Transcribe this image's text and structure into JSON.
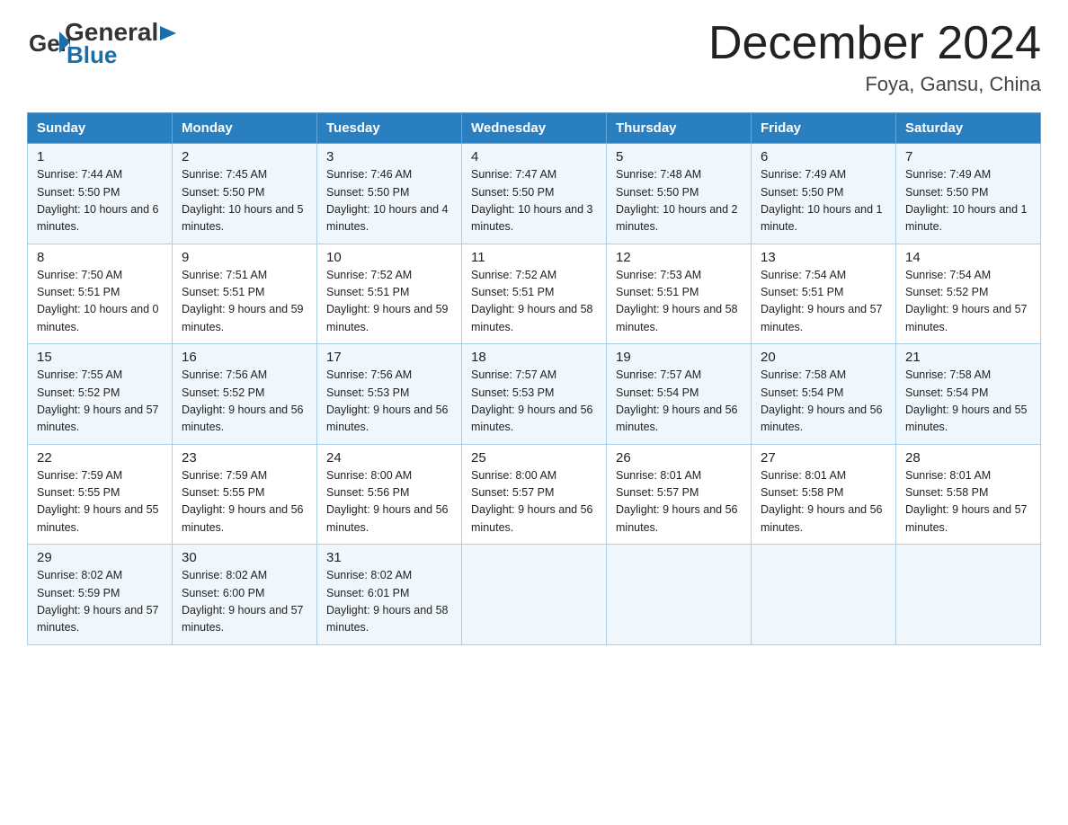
{
  "header": {
    "logo_general": "General",
    "logo_blue": "Blue",
    "month_title": "December 2024",
    "location": "Foya, Gansu, China"
  },
  "days_of_week": [
    "Sunday",
    "Monday",
    "Tuesday",
    "Wednesday",
    "Thursday",
    "Friday",
    "Saturday"
  ],
  "weeks": [
    [
      {
        "day": "1",
        "sunrise": "7:44 AM",
        "sunset": "5:50 PM",
        "daylight": "10 hours and 6 minutes."
      },
      {
        "day": "2",
        "sunrise": "7:45 AM",
        "sunset": "5:50 PM",
        "daylight": "10 hours and 5 minutes."
      },
      {
        "day": "3",
        "sunrise": "7:46 AM",
        "sunset": "5:50 PM",
        "daylight": "10 hours and 4 minutes."
      },
      {
        "day": "4",
        "sunrise": "7:47 AM",
        "sunset": "5:50 PM",
        "daylight": "10 hours and 3 minutes."
      },
      {
        "day": "5",
        "sunrise": "7:48 AM",
        "sunset": "5:50 PM",
        "daylight": "10 hours and 2 minutes."
      },
      {
        "day": "6",
        "sunrise": "7:49 AM",
        "sunset": "5:50 PM",
        "daylight": "10 hours and 1 minute."
      },
      {
        "day": "7",
        "sunrise": "7:49 AM",
        "sunset": "5:50 PM",
        "daylight": "10 hours and 1 minute."
      }
    ],
    [
      {
        "day": "8",
        "sunrise": "7:50 AM",
        "sunset": "5:51 PM",
        "daylight": "10 hours and 0 minutes."
      },
      {
        "day": "9",
        "sunrise": "7:51 AM",
        "sunset": "5:51 PM",
        "daylight": "9 hours and 59 minutes."
      },
      {
        "day": "10",
        "sunrise": "7:52 AM",
        "sunset": "5:51 PM",
        "daylight": "9 hours and 59 minutes."
      },
      {
        "day": "11",
        "sunrise": "7:52 AM",
        "sunset": "5:51 PM",
        "daylight": "9 hours and 58 minutes."
      },
      {
        "day": "12",
        "sunrise": "7:53 AM",
        "sunset": "5:51 PM",
        "daylight": "9 hours and 58 minutes."
      },
      {
        "day": "13",
        "sunrise": "7:54 AM",
        "sunset": "5:51 PM",
        "daylight": "9 hours and 57 minutes."
      },
      {
        "day": "14",
        "sunrise": "7:54 AM",
        "sunset": "5:52 PM",
        "daylight": "9 hours and 57 minutes."
      }
    ],
    [
      {
        "day": "15",
        "sunrise": "7:55 AM",
        "sunset": "5:52 PM",
        "daylight": "9 hours and 57 minutes."
      },
      {
        "day": "16",
        "sunrise": "7:56 AM",
        "sunset": "5:52 PM",
        "daylight": "9 hours and 56 minutes."
      },
      {
        "day": "17",
        "sunrise": "7:56 AM",
        "sunset": "5:53 PM",
        "daylight": "9 hours and 56 minutes."
      },
      {
        "day": "18",
        "sunrise": "7:57 AM",
        "sunset": "5:53 PM",
        "daylight": "9 hours and 56 minutes."
      },
      {
        "day": "19",
        "sunrise": "7:57 AM",
        "sunset": "5:54 PM",
        "daylight": "9 hours and 56 minutes."
      },
      {
        "day": "20",
        "sunrise": "7:58 AM",
        "sunset": "5:54 PM",
        "daylight": "9 hours and 56 minutes."
      },
      {
        "day": "21",
        "sunrise": "7:58 AM",
        "sunset": "5:54 PM",
        "daylight": "9 hours and 55 minutes."
      }
    ],
    [
      {
        "day": "22",
        "sunrise": "7:59 AM",
        "sunset": "5:55 PM",
        "daylight": "9 hours and 55 minutes."
      },
      {
        "day": "23",
        "sunrise": "7:59 AM",
        "sunset": "5:55 PM",
        "daylight": "9 hours and 56 minutes."
      },
      {
        "day": "24",
        "sunrise": "8:00 AM",
        "sunset": "5:56 PM",
        "daylight": "9 hours and 56 minutes."
      },
      {
        "day": "25",
        "sunrise": "8:00 AM",
        "sunset": "5:57 PM",
        "daylight": "9 hours and 56 minutes."
      },
      {
        "day": "26",
        "sunrise": "8:01 AM",
        "sunset": "5:57 PM",
        "daylight": "9 hours and 56 minutes."
      },
      {
        "day": "27",
        "sunrise": "8:01 AM",
        "sunset": "5:58 PM",
        "daylight": "9 hours and 56 minutes."
      },
      {
        "day": "28",
        "sunrise": "8:01 AM",
        "sunset": "5:58 PM",
        "daylight": "9 hours and 57 minutes."
      }
    ],
    [
      {
        "day": "29",
        "sunrise": "8:02 AM",
        "sunset": "5:59 PM",
        "daylight": "9 hours and 57 minutes."
      },
      {
        "day": "30",
        "sunrise": "8:02 AM",
        "sunset": "6:00 PM",
        "daylight": "9 hours and 57 minutes."
      },
      {
        "day": "31",
        "sunrise": "8:02 AM",
        "sunset": "6:01 PM",
        "daylight": "9 hours and 58 minutes."
      },
      {
        "day": "",
        "sunrise": "",
        "sunset": "",
        "daylight": ""
      },
      {
        "day": "",
        "sunrise": "",
        "sunset": "",
        "daylight": ""
      },
      {
        "day": "",
        "sunrise": "",
        "sunset": "",
        "daylight": ""
      },
      {
        "day": "",
        "sunrise": "",
        "sunset": "",
        "daylight": ""
      }
    ]
  ]
}
